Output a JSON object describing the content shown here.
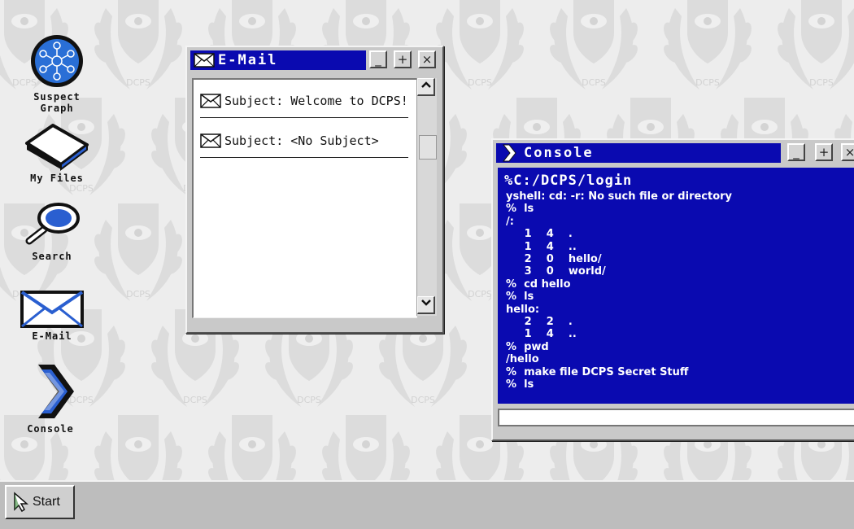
{
  "desktop": {
    "watermark_text": "DCPS",
    "icons": [
      {
        "label_line1": "Suspect",
        "label_line2": "Graph",
        "icon": "network-graph-icon"
      },
      {
        "label": "My Files",
        "icon": "folder-icon"
      },
      {
        "label": "Search",
        "icon": "magnifier-icon"
      },
      {
        "label": "E-Mail",
        "icon": "envelope-icon"
      },
      {
        "label": "Console",
        "icon": "chevron-icon"
      }
    ]
  },
  "email_window": {
    "title": "E-Mail",
    "buttons": {
      "minimize": "_",
      "maximize": "+",
      "close": "×"
    },
    "messages": [
      {
        "subject": "Subject: Welcome to DCPS!"
      },
      {
        "subject": "Subject: <No Subject>"
      }
    ]
  },
  "console_window": {
    "title": "Console",
    "buttons": {
      "minimize": "_",
      "maximize": "+",
      "close": "×"
    },
    "prompt": "%C:/DCPS/login",
    "lines": [
      "yshell: cd: -r: No such file or directory",
      "%  ls",
      "/:",
      "     1    4    .",
      "     1    4    ..",
      "     2    0    hello/",
      "     3    0    world/",
      "%  cd hello",
      "%  ls",
      "hello:",
      "     2    2    .",
      "     1    4    ..",
      "%  pwd",
      "/hello",
      "%  make file DCPS Secret Stuff",
      "%  ls"
    ],
    "input_value": ""
  },
  "taskbar": {
    "start_label": "Start"
  },
  "colors": {
    "title_blue": "#0a0ab0",
    "desktop_bg": "#ededed",
    "taskbar_bg": "#bdbdbd"
  }
}
